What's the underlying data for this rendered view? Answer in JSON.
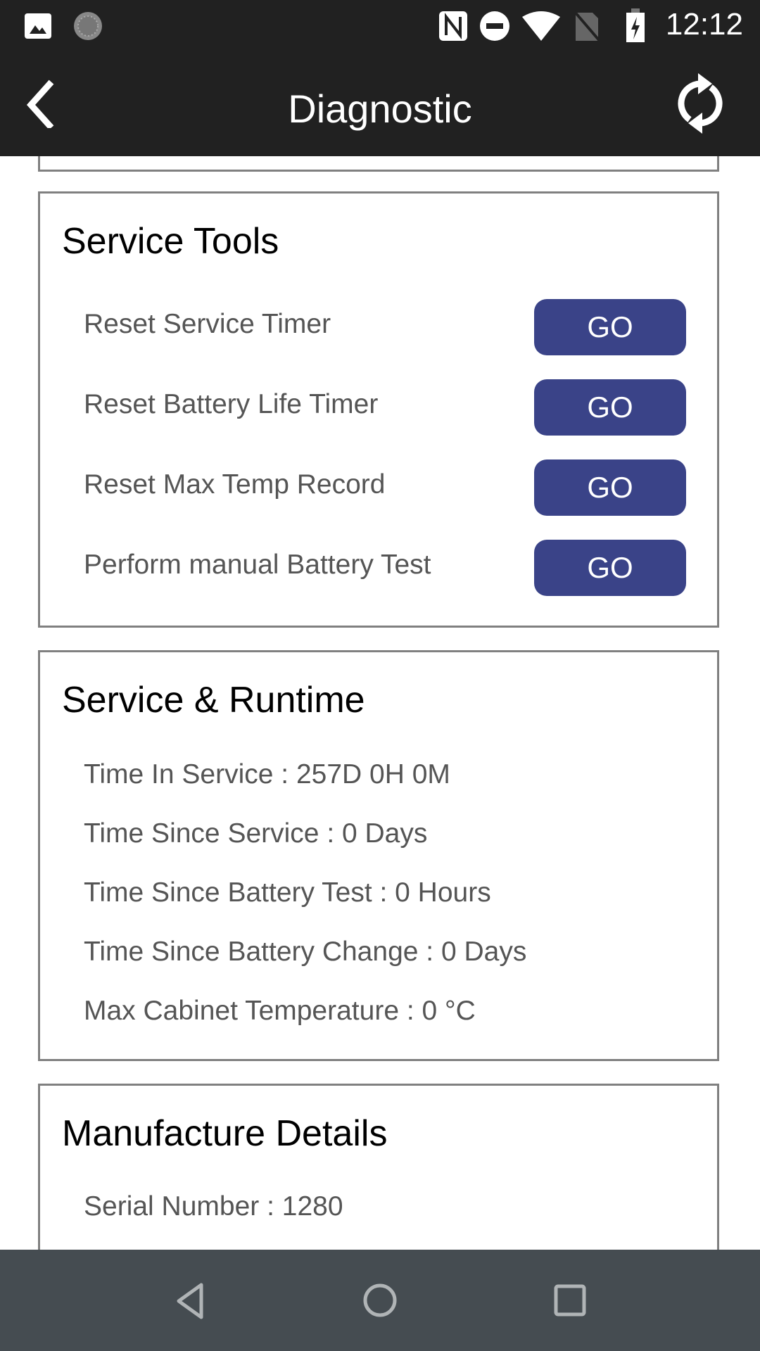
{
  "status_bar": {
    "time": "12:12",
    "icons": [
      "image-icon",
      "sync-progress-icon",
      "nfc-icon",
      "do-not-disturb-icon",
      "wifi-icon",
      "no-sim-icon",
      "battery-charging-icon"
    ]
  },
  "app_bar": {
    "title": "Diagnostic",
    "back_icon": "chevron-left-icon",
    "refresh_icon": "refresh-icon"
  },
  "service_tools": {
    "title": "Service Tools",
    "items": [
      {
        "label": "Reset Service Timer",
        "button": "GO"
      },
      {
        "label": "Reset Battery Life Timer",
        "button": "GO"
      },
      {
        "label": "Reset Max Temp Record",
        "button": "GO"
      },
      {
        "label": "Perform manual Battery Test",
        "button": "GO"
      }
    ]
  },
  "service_runtime": {
    "title": "Service & Runtime",
    "items": [
      {
        "text": "Time In Service :  257D 0H 0M"
      },
      {
        "text": "Time Since Service :  0 Days"
      },
      {
        "text": "Time Since Battery Test :  0 Hours"
      },
      {
        "text": "Time Since Battery Change :  0 Days"
      },
      {
        "text": "Max Cabinet Temperature :  0 °C"
      }
    ]
  },
  "manufacture_details": {
    "title": "Manufacture Details",
    "items": [
      {
        "text": "Serial Number :  1280"
      }
    ]
  },
  "nav_bar": {
    "buttons": [
      "back-icon",
      "home-icon",
      "recents-icon"
    ]
  },
  "colors": {
    "accent": "#3a4388",
    "header": "#212121",
    "navbar": "#454c51"
  }
}
